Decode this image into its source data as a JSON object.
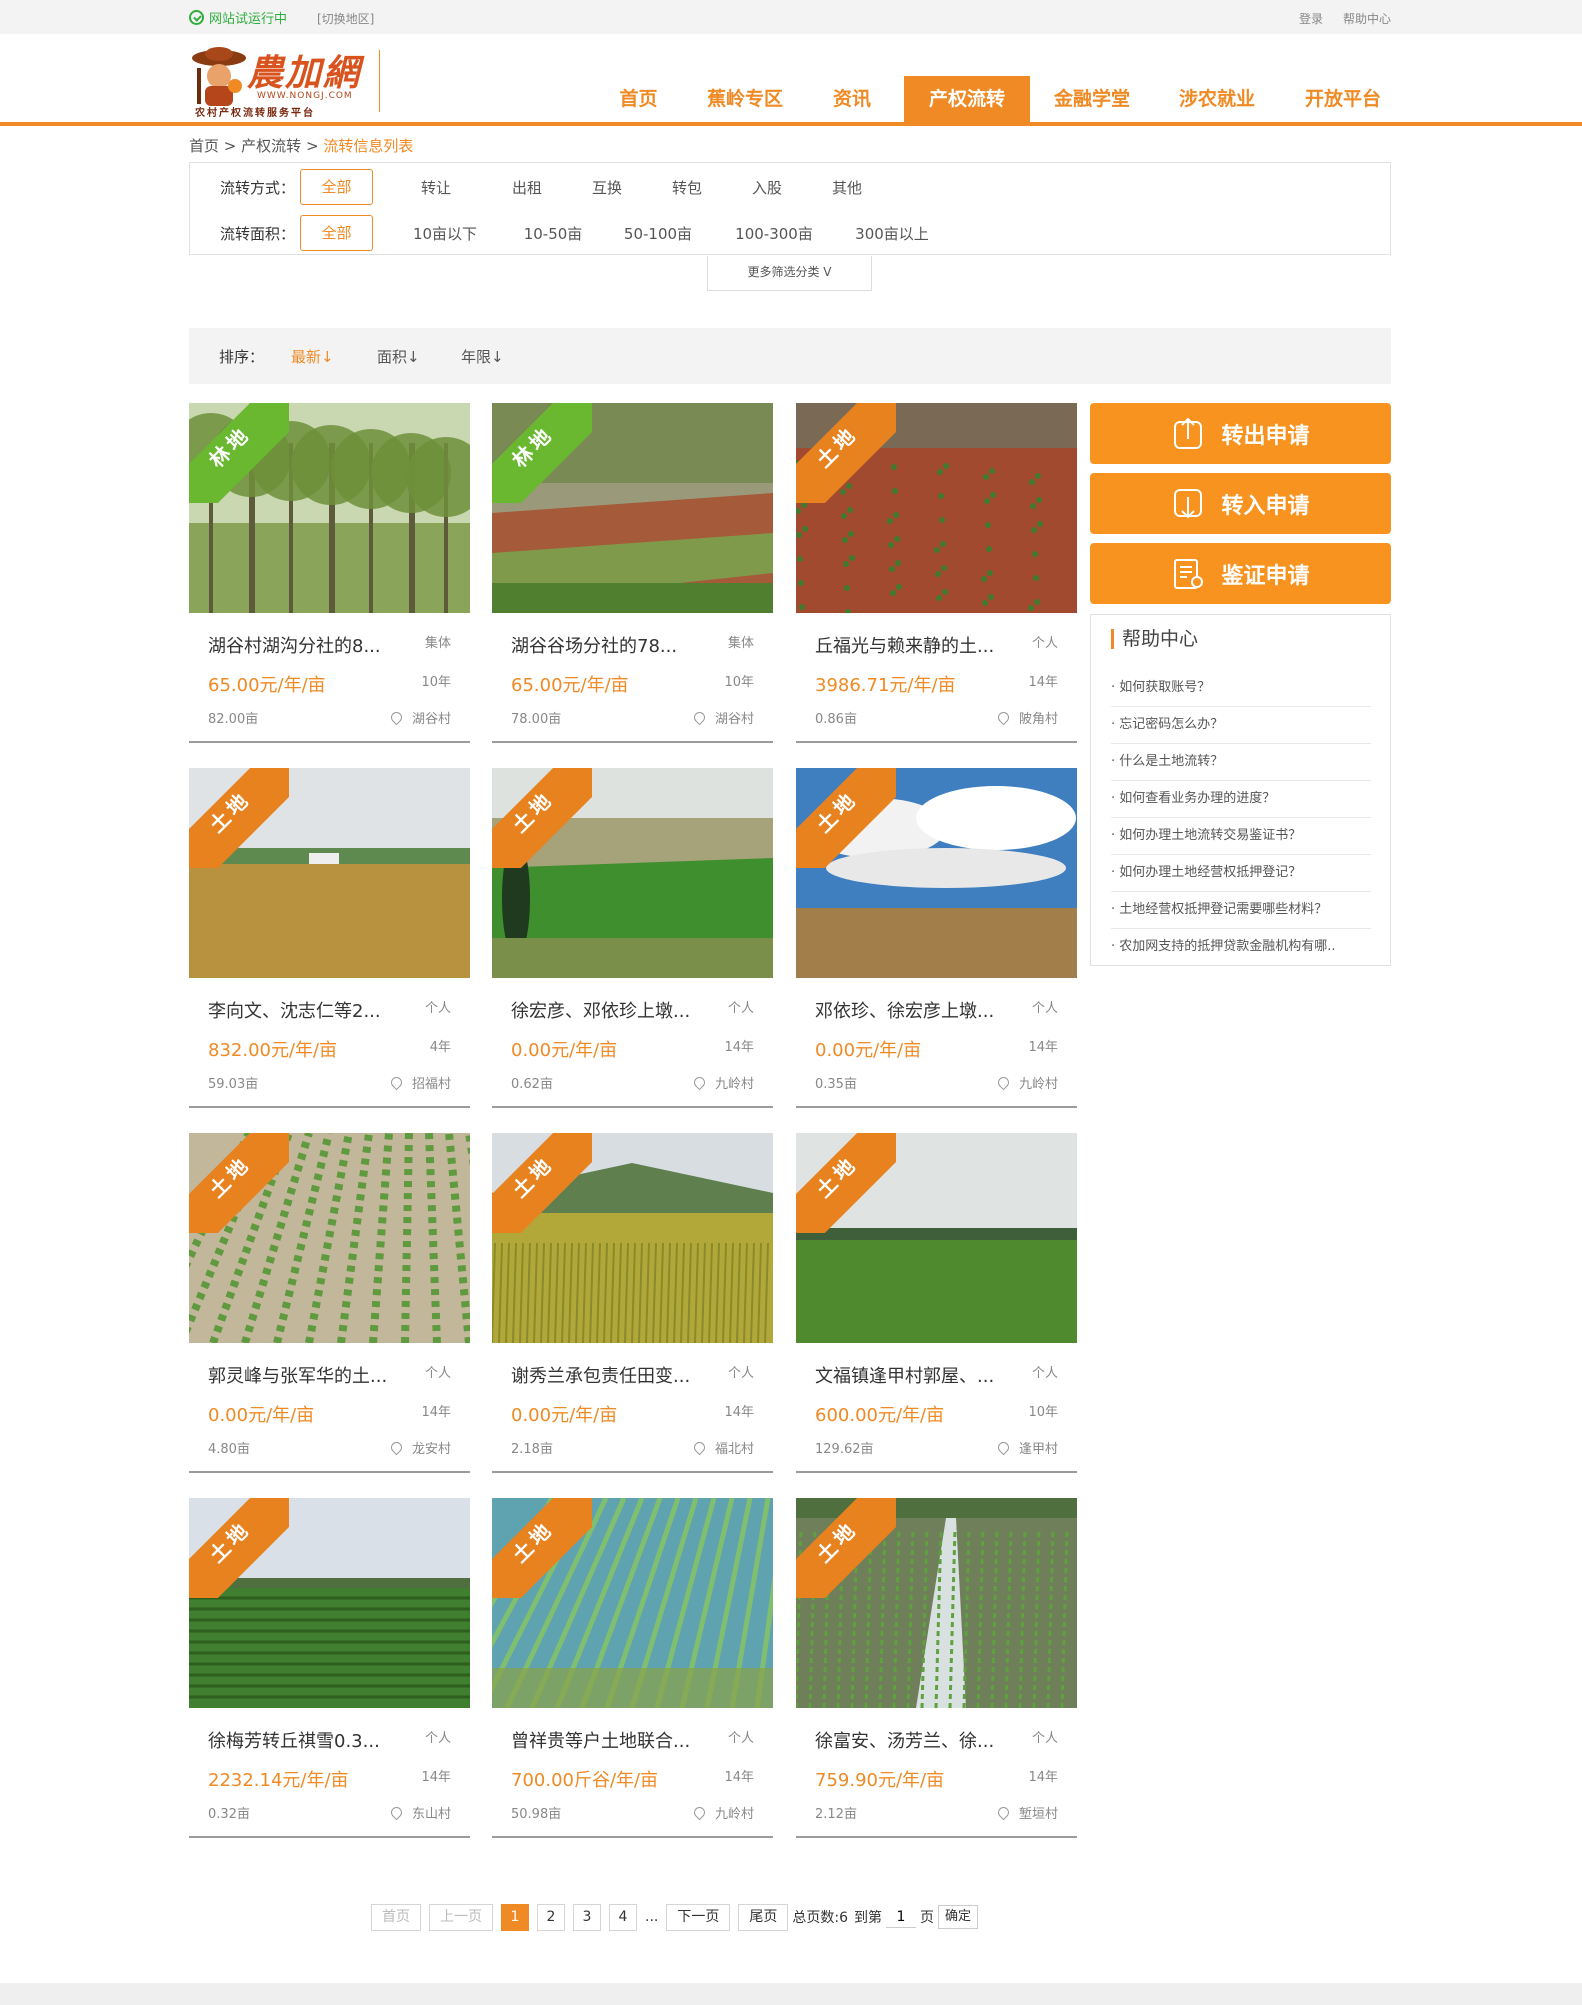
{
  "topbar": {
    "trial": "网站试运行中",
    "switch_region": "[切换地区]",
    "login": "登录",
    "help": "帮助中心"
  },
  "logo": {
    "name": "農加網",
    "url": "WWW.NONGJ.COM",
    "slogan": "农村产权流转服务平台"
  },
  "nav": [
    "首页",
    "蕉岭专区",
    "资讯",
    "产权流转",
    "金融学堂",
    "涉农就业",
    "开放平台"
  ],
  "nav_active": "产权流转",
  "breadcrumb": {
    "home": "首页",
    "sep": ">",
    "level1": "产权流转",
    "current": "流转信息列表"
  },
  "filters": {
    "method": {
      "label": "流转方式：",
      "options": [
        "全部",
        "转让",
        "出租",
        "互换",
        "转包",
        "入股",
        "其他"
      ]
    },
    "area": {
      "label": "流转面积：",
      "options": [
        "全部",
        "10亩以下",
        "10-50亩",
        "50-100亩",
        "100-300亩",
        "300亩以上"
      ]
    },
    "more": "更多筛选分类 V"
  },
  "sort": {
    "label": "排序：",
    "latest": "最新↓",
    "area": "面积↓",
    "years": "年限↓"
  },
  "colors": {
    "accent": "#f08a24",
    "button": "#f7931e",
    "forest_tag": "#6ab830",
    "land_tag": "#e8821f"
  },
  "listings": [
    {
      "tag": "林地",
      "title": "湖谷村湖沟分社的8...",
      "owner": "集体",
      "price": "65.00元/年/亩",
      "years": "10年",
      "area": "82.00亩",
      "village": "湖谷村",
      "scene": "trees"
    },
    {
      "tag": "林地",
      "title": "湖谷谷场分社的78...",
      "owner": "集体",
      "price": "65.00元/年/亩",
      "years": "10年",
      "area": "78.00亩",
      "village": "湖谷村",
      "scene": "terrace"
    },
    {
      "tag": "土地",
      "title": "丘福光与赖来静的土...",
      "owner": "个人",
      "price": "3986.71元/年/亩",
      "years": "14年",
      "area": "0.86亩",
      "village": "陂角村",
      "scene": "redsoil"
    },
    {
      "tag": "土地",
      "title": "李向文、沈志仁等2...",
      "owner": "个人",
      "price": "832.00元/年/亩",
      "years": "4年",
      "area": "59.03亩",
      "village": "招福村",
      "scene": "village"
    },
    {
      "tag": "土地",
      "title": "徐宏彦、邓依珍上墩...",
      "owner": "个人",
      "price": "0.00元/年/亩",
      "years": "14年",
      "area": "0.62亩",
      "village": "九岭村",
      "scene": "greenfield"
    },
    {
      "tag": "土地",
      "title": "邓依珍、徐宏彦上墩...",
      "owner": "个人",
      "price": "0.00元/年/亩",
      "years": "14年",
      "area": "0.35亩",
      "village": "九岭村",
      "scene": "clouds"
    },
    {
      "tag": "土地",
      "title": "郭灵峰与张军华的土...",
      "owner": "个人",
      "price": "0.00元/年/亩",
      "years": "14年",
      "area": "4.80亩",
      "village": "龙安村",
      "scene": "rows"
    },
    {
      "tag": "土地",
      "title": "谢秀兰承包责任田变...",
      "owner": "个人",
      "price": "0.00元/年/亩",
      "years": "14年",
      "area": "2.18亩",
      "village": "福北村",
      "scene": "rice"
    },
    {
      "tag": "土地",
      "title": "文福镇逢甲村郭屋、...",
      "owner": "个人",
      "price": "600.00元/年/亩",
      "years": "10年",
      "area": "129.62亩",
      "village": "逢甲村",
      "scene": "grass"
    },
    {
      "tag": "土地",
      "title": "徐梅芳转丘祺雪0.3...",
      "owner": "个人",
      "price": "2232.14元/年/亩",
      "years": "14年",
      "area": "0.32亩",
      "village": "东山村",
      "scene": "crops"
    },
    {
      "tag": "土地",
      "title": "曾祥贵等户土地联合...",
      "owner": "个人",
      "price": "700.00斤谷/年/亩",
      "years": "14年",
      "area": "50.98亩",
      "village": "九岭村",
      "scene": "paddy"
    },
    {
      "tag": "土地",
      "title": "徐富安、汤芳兰、徐...",
      "owner": "个人",
      "price": "759.90元/年/亩",
      "years": "14年",
      "area": "2.12亩",
      "village": "堑垣村",
      "scene": "seedling"
    }
  ],
  "sidebar": {
    "buttons": [
      {
        "label": "转出申请",
        "icon": "upload-icon"
      },
      {
        "label": "转入申请",
        "icon": "download-icon"
      },
      {
        "label": "鉴证申请",
        "icon": "certificate-icon"
      }
    ],
    "help_title": "帮助中心",
    "help_items": [
      "· 如何获取账号？",
      "· 忘记密码怎么办？",
      "· 什么是土地流转？",
      "· 如何查看业务办理的进度？",
      "· 如何办理土地流转交易鉴证书？",
      "· 如何办理土地经营权抵押登记？",
      "· 土地经营权抵押登记需要哪些材料？",
      "· 农加网支持的抵押贷款金融机构有哪.."
    ]
  },
  "pager": {
    "first": "首页",
    "prev": "上一页",
    "pages": [
      "1",
      "2",
      "3",
      "4"
    ],
    "current": "1",
    "ellipsis": "...",
    "next": "下一页",
    "last": "尾页",
    "total": "总页数:6",
    "goto": "到第",
    "goto_value": "1",
    "page_unit": "页",
    "confirm": "确定"
  }
}
